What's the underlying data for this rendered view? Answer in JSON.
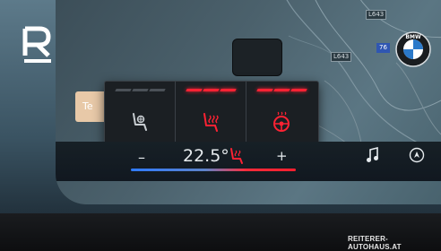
{
  "map": {
    "road_labels": [
      "L643",
      "L643",
      "76"
    ]
  },
  "seat_panel": {
    "partial_label": "Te",
    "controls": [
      {
        "name": "seat-ventilation",
        "level": 0,
        "max": 3
      },
      {
        "name": "seat-heating",
        "level": 3,
        "max": 3
      },
      {
        "name": "steering-wheel-heating",
        "level": 3,
        "max": 3
      }
    ]
  },
  "climate": {
    "minus": "–",
    "temperature": "22.5°",
    "plus": "+"
  },
  "logos": {
    "brand": "R",
    "car_brand": "BMW"
  },
  "watermark": "REITERER-AUTOHAUS.AT",
  "colors": {
    "active_red": "#ff2233",
    "inactive_grey": "#4b5158",
    "cool_blue": "#2f7bff"
  }
}
